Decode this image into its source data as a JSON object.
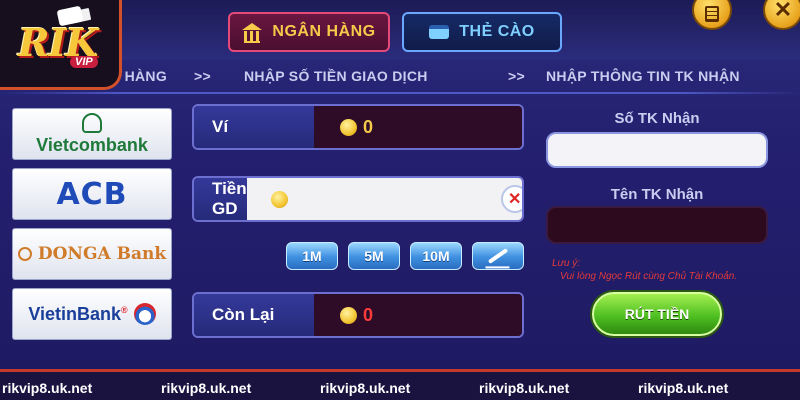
{
  "logo": {
    "text": "RIK",
    "sub": "VIP"
  },
  "tabs": [
    {
      "label": "NGÂN HÀNG",
      "icon": "bank-icon",
      "active": true
    },
    {
      "label": "THẺ CÀO",
      "icon": "card-icon",
      "active": false
    }
  ],
  "corner_buttons": [
    {
      "name": "history-button",
      "icon": "document-icon"
    },
    {
      "name": "close-button",
      "icon": "close-icon",
      "glyph": "✕"
    }
  ],
  "steps": {
    "step1": "N HÀNG",
    "arrow": ">>",
    "step2": "NHẬP SỐ TIỀN GIAO DỊCH",
    "step3": "NHẬP THÔNG TIN TK NHẬN"
  },
  "banks": [
    {
      "name": "Vietcombank",
      "icon": "vietcombank-logo"
    },
    {
      "name": "ACB",
      "icon": "acb-logo"
    },
    {
      "name": "DONGA Bank",
      "icon": "donga-logo"
    },
    {
      "name_main": "VietinBank",
      "name_sup": "®",
      "icon": "vietinbank-logo"
    }
  ],
  "form": {
    "wallet_label": "Ví",
    "wallet_value": "0",
    "amount_label": "Tiền GD",
    "amount_value": "",
    "amount_placeholder": "",
    "clear_glyph": "✕",
    "remaining_label": "Còn Lại",
    "remaining_value": "0"
  },
  "quick_amounts": [
    "1M",
    "5M",
    "10M"
  ],
  "recipient": {
    "account_label": "Số TK Nhận",
    "account_value": "",
    "name_label": "Tên TK Nhận",
    "name_value": "",
    "note_title": "Lưu ý:",
    "note_text": "Vui lòng Ngọc Rút cùng Chủ Tài Khoản.",
    "submit_label": "RÚT TIỀN"
  },
  "watermark": "rikvip8.uk.net",
  "colors": {
    "accent_gold": "#f7c94a",
    "danger": "#ff3b3b",
    "button_green": "#4fbf22",
    "quick_blue": "#3e8fe0"
  }
}
